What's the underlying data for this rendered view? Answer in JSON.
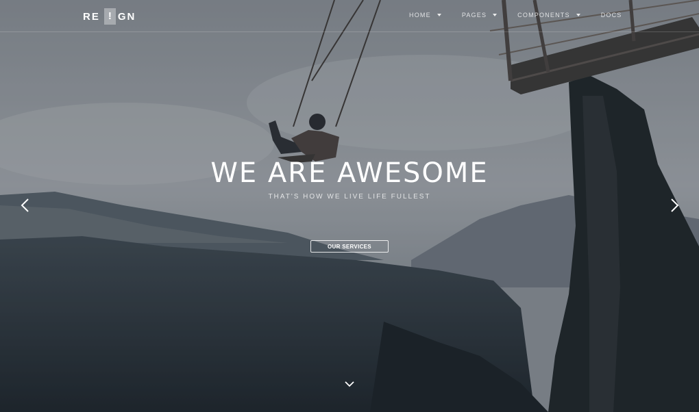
{
  "brand": {
    "left": "RE",
    "middle": "!",
    "right": "GN"
  },
  "nav": [
    {
      "label": "HOME",
      "icon": "chevron-down-icon"
    },
    {
      "label": "PAGES",
      "icon": "chevron-down-icon"
    },
    {
      "label": "COMPONENTS",
      "icon": "chevron-down-icon"
    },
    {
      "label": "DOCS",
      "icon": ""
    }
  ],
  "hero": {
    "headline": "WE ARE AWESOME",
    "subline": "THAT'S HOW WE LIVE LIFE FULLEST",
    "cta_label": "OUR SERVICES"
  },
  "controls": {
    "prev_icon": "chevron-left-icon",
    "next_icon": "chevron-right-icon",
    "scroll_icon": "chevron-down-icon"
  },
  "colors": {
    "sky": "#9aa0a6",
    "mountain": "#5d6772",
    "forest": "#263038",
    "tree": "#1e252a"
  }
}
